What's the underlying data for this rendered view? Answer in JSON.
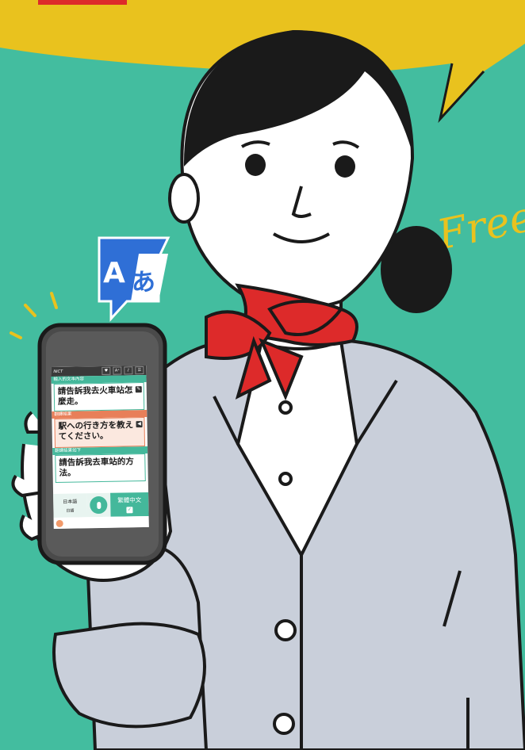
{
  "colors": {
    "background": "#43bd9f",
    "speech_bubble": "#e9c21e",
    "scarf": "#dd2a2a",
    "jacket": "#c9cfda",
    "accent_green": "#44b89b",
    "accent_orange": "#e87f59",
    "translate_icon_blue": "#2f6fd6"
  },
  "decoration": {
    "free_text": "Free"
  },
  "translate_icon": {
    "latin_letter": "A",
    "kana_letter": "あ"
  },
  "phone": {
    "input_label": "輸入的文本內容",
    "input_text": "請告訴我去火車站怎麼走。",
    "result_label": "翻譯結果",
    "result_text": "駅への行き方を教えてください。",
    "back_label": "翻譯結果如下",
    "back_text": "請告訴我去車站的方法。",
    "source_language": "日本語",
    "source_language_sub": "日語",
    "target_language": "繁體中文",
    "toolbar": [
      "♥",
      "A⁺",
      "♪",
      "☰"
    ]
  },
  "icons": [
    "translate-icon",
    "microphone-icon",
    "edit-icon",
    "globe-icon"
  ]
}
